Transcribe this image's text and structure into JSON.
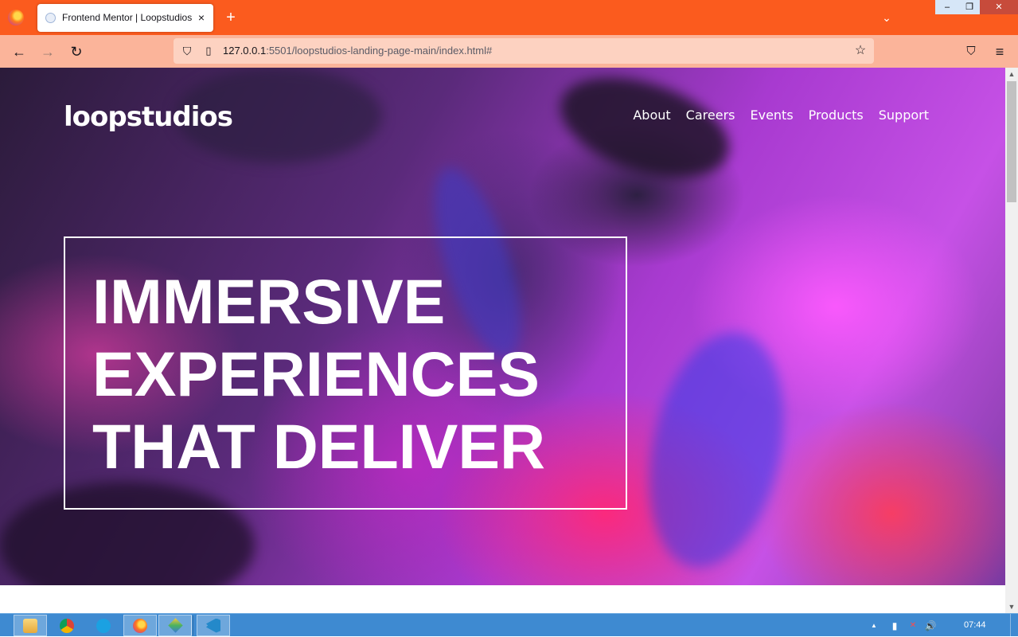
{
  "browser": {
    "tab": {
      "title": "Frontend Mentor | Loopstudios landing page",
      "close_icon": "×"
    },
    "new_tab_icon": "+",
    "tab_list_icon": "⌄",
    "window_controls": {
      "minimize": "–",
      "maximize": "❐",
      "close": "✕"
    },
    "toolbar": {
      "back_icon": "←",
      "forward_icon": "→",
      "reload_icon": "↻"
    },
    "url": {
      "host": "127.0.0.1",
      "rest": ":5501/loopstudios-landing-page-main/index.html#"
    },
    "icons": {
      "shield": "⛉",
      "page": "▯",
      "bookmark_star": "☆",
      "pocket": "⛉",
      "menu": "≡"
    }
  },
  "page": {
    "logo": "loopstudios",
    "nav": [
      "About",
      "Careers",
      "Events",
      "Products",
      "Support"
    ],
    "headline": [
      "IMMERSIVE",
      "EXPERIENCES",
      "THAT DELIVER"
    ]
  },
  "scrollbar": {
    "up": "▲",
    "down": "▼"
  },
  "taskbar": {
    "tray": {
      "overflow": "▲",
      "battery": "▮",
      "network": "✕",
      "volume": "🔊"
    },
    "clock": "07:44"
  },
  "colors": {
    "tab_strip": "#fb5b1e",
    "toolbar": "#fbb49a",
    "urlbar": "#fdd2c1",
    "taskbar": "#3e8ad1",
    "hero_magenta": "#c651e6",
    "text_white": "#ffffff"
  }
}
